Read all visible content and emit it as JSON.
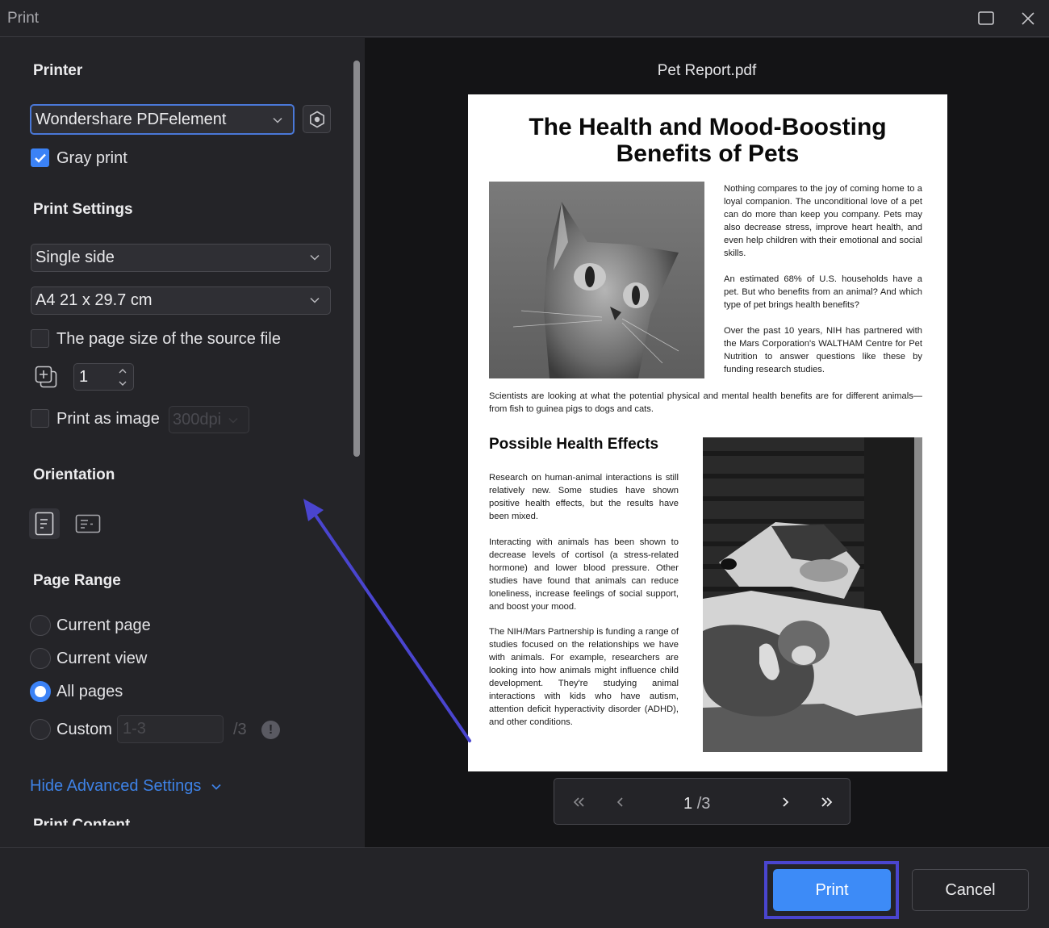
{
  "window": {
    "title": "Print",
    "maximize_icon": "maximize-icon",
    "close_icon": "close-icon"
  },
  "printer": {
    "heading": "Printer",
    "selected": "Wondershare PDFelement",
    "settings_icon": "printer-properties-icon",
    "gray_print": {
      "label": "Gray print",
      "checked": true
    }
  },
  "print_settings": {
    "heading": "Print Settings",
    "sides": "Single side",
    "paper_size": "A4 21 x 29.7 cm",
    "source_page_size": {
      "label": "The page size of the source file",
      "checked": false
    },
    "copies": {
      "icon": "copies-icon",
      "value": "1"
    },
    "print_as_image": {
      "label": "Print as image",
      "checked": false,
      "dpi": "300dpi"
    }
  },
  "orientation": {
    "heading": "Orientation",
    "options": [
      {
        "name": "portrait",
        "active": true
      },
      {
        "name": "landscape",
        "active": false
      }
    ]
  },
  "page_range": {
    "heading": "Page Range",
    "options": [
      {
        "label": "Current page",
        "checked": false
      },
      {
        "label": "Current view",
        "checked": false
      },
      {
        "label": "All pages",
        "checked": true
      },
      {
        "label": "Custom",
        "checked": false
      }
    ],
    "custom_placeholder": "1-3",
    "custom_total": "/3",
    "info_glyph": "!"
  },
  "advanced": {
    "toggle_label": "Hide Advanced Settings",
    "next_heading": "Print Content"
  },
  "preview": {
    "file_name": "Pet Report.pdf",
    "document": {
      "title_line1": "The Health and Mood-Boosting",
      "title_line2": "Benefits of Pets",
      "intro_paragraphs": [
        "Nothing compares to the joy of coming home to a loyal companion. The unconditional love of a pet can do more than keep you company. Pets may also decrease stress, improve heart health, and even help children with their emotional and social skills.",
        "An estimated 68% of U.S. households have a pet. But who benefits from an animal? And which type of pet brings health benefits?",
        "Over the past 10 years, NIH has partnered with the Mars Corporation's WALTHAM Centre for Pet Nutrition to answer questions like these by funding research studies."
      ],
      "full_width_paragraph": "Scientists are looking at what the potential physical and mental health benefits are for different animals—from fish to guinea pigs to dogs and cats.",
      "section_heading": "Possible Health Effects",
      "section_paragraphs": [
        "Research on human-animal interactions is still relatively new. Some studies have shown positive health effects, but the results have been mixed.",
        "Interacting with animals has been shown to decrease levels of cortisol (a stress-related hormone) and lower blood pressure. Other studies have found that animals can reduce loneliness, increase feelings of social support, and boost your mood.",
        "The NIH/Mars Partnership is funding a range of studies focused on the relationships we have with animals. For example, researchers are looking into how animals might influence child development. They're studying animal interactions with kids who have autism, attention deficit hyperactivity disorder (ADHD), and other conditions."
      ],
      "images": [
        {
          "name": "cat-photo",
          "description": "Black and white photo of a tabby cat looking upward"
        },
        {
          "name": "dog-and-cat-photo",
          "description": "Black and white photo of a dog resting with a kitten"
        }
      ]
    },
    "pager": {
      "current_page": "1",
      "total_pages": "/3",
      "first_icon": "first-page-icon",
      "prev_icon": "previous-page-icon",
      "next_icon": "next-page-icon",
      "last_icon": "last-page-icon"
    }
  },
  "footer": {
    "print_label": "Print",
    "cancel_label": "Cancel"
  },
  "colors": {
    "accent": "#3d8bf7",
    "link": "#3e82e6",
    "annotation": "#4a45cf",
    "panel_bg": "#242428",
    "preview_bg": "#141416"
  }
}
